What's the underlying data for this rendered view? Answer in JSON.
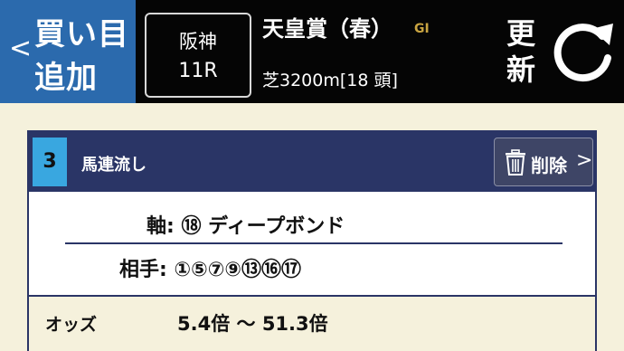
{
  "header": {
    "back": {
      "chevron": "<",
      "line1": "買い目",
      "line2": "追加"
    },
    "venue": {
      "name": "阪神",
      "race_number": "11R"
    },
    "race": {
      "name": "天皇賞（春）",
      "grade": "GI",
      "info": "芝3200m[18 頭]"
    },
    "refresh": {
      "line1": "更",
      "line2": "新",
      "icon": "refresh-icon"
    }
  },
  "bet_card": {
    "number": "3",
    "bet_type": "馬連流し",
    "delete": {
      "label": "削除",
      "chevron": ">",
      "icon": "trash-icon"
    },
    "axis": "軸: ⑱ ディープボンド",
    "partners": "相手: ①⑤⑦⑨⑬⑯⑰",
    "odds_label": "オッズ",
    "odds_value": "5.4倍 ～ 51.3倍"
  },
  "colors": {
    "header_bg": "#050505",
    "back_button": "#2b6aad",
    "card_header": "#2a3566",
    "badge": "#39a7e0",
    "grade": "#c9a441",
    "page_bg": "#f5f1dc"
  }
}
